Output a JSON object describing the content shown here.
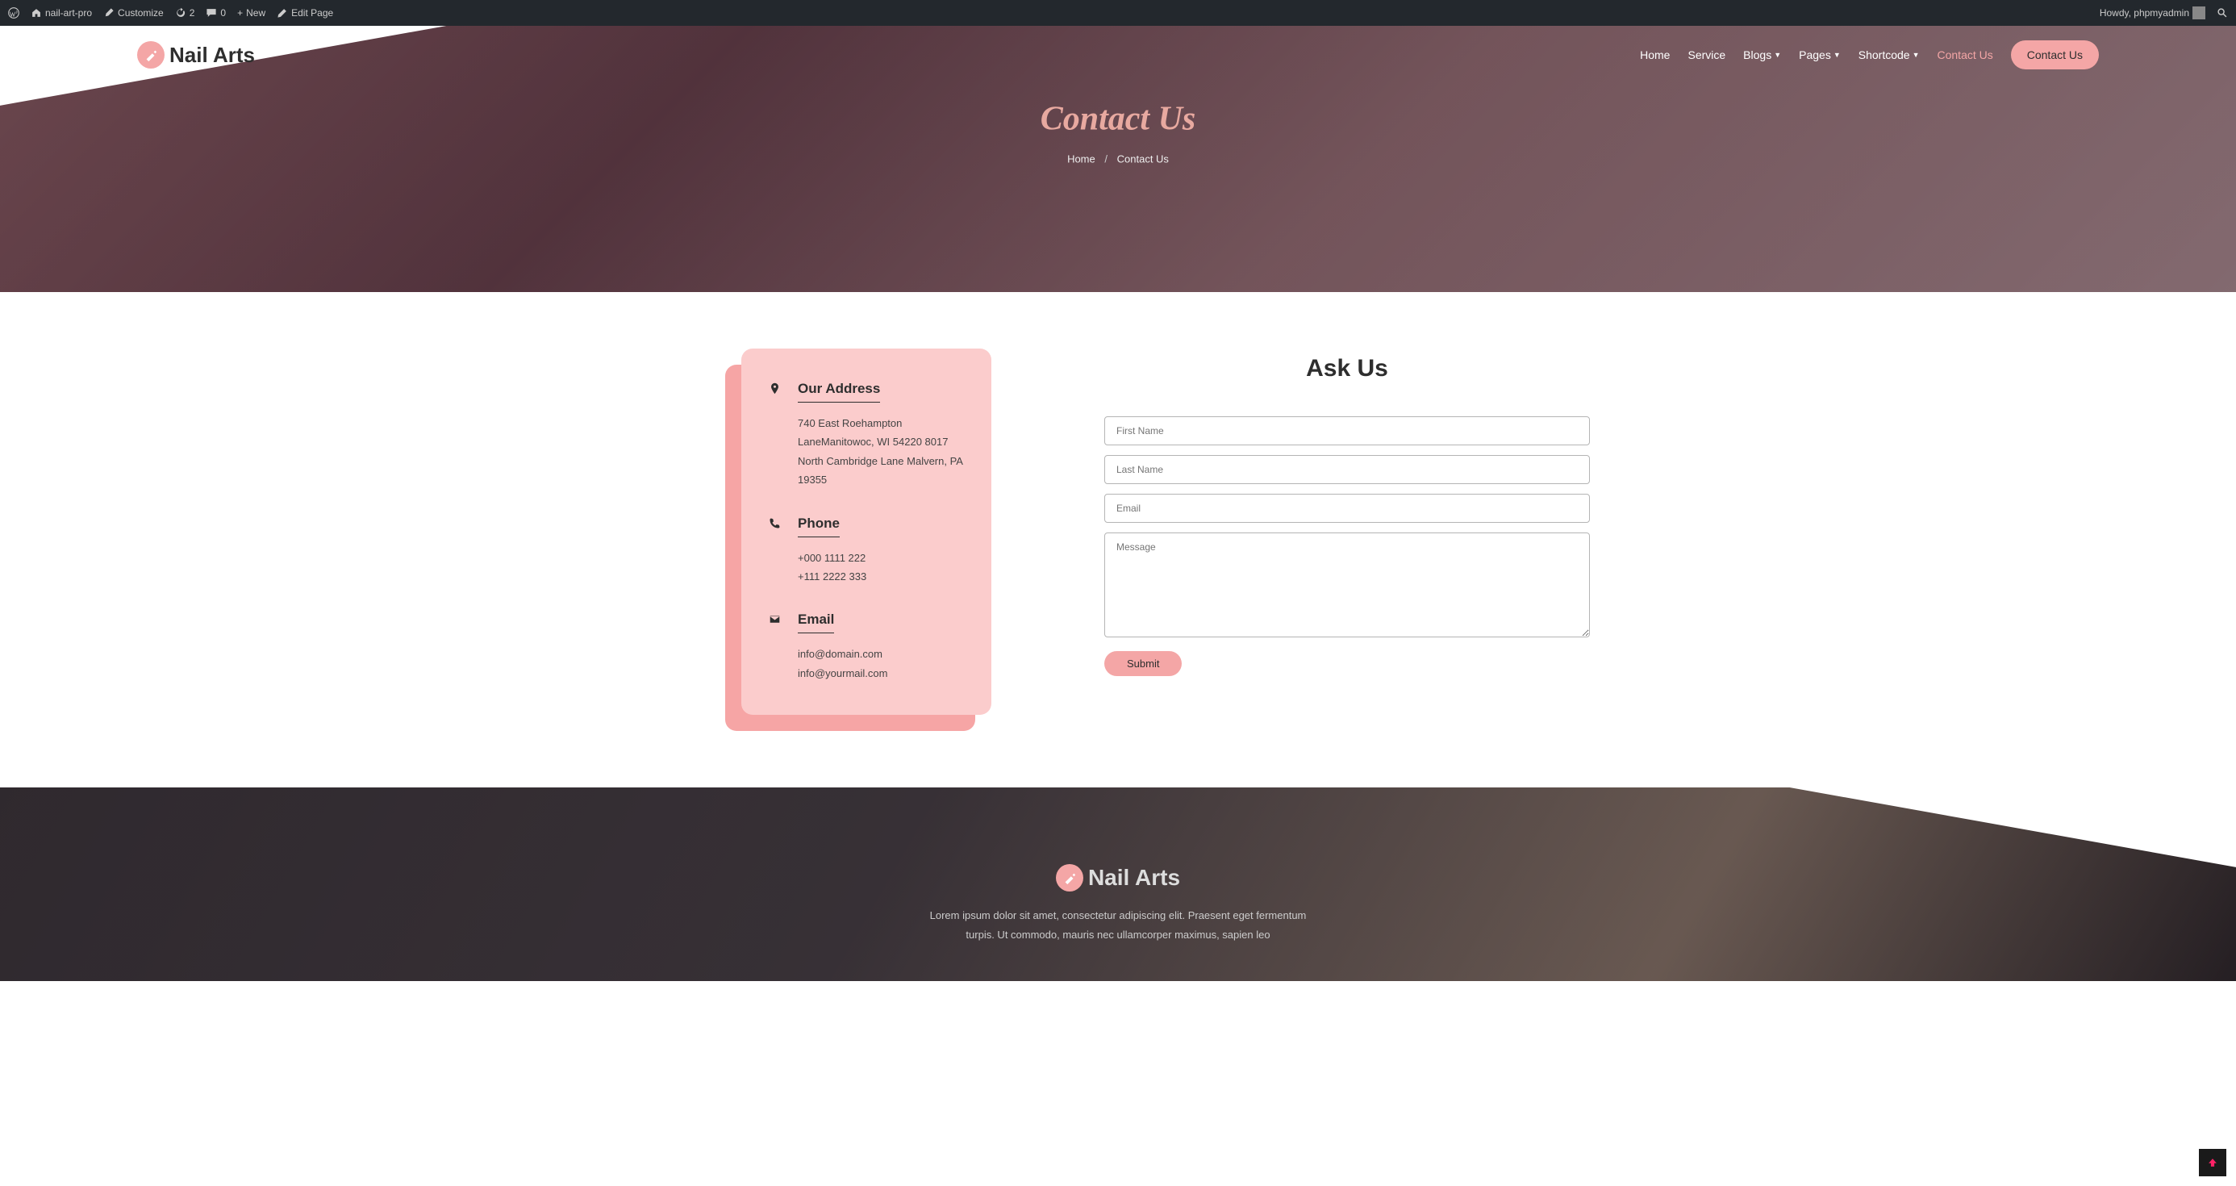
{
  "wp_bar": {
    "site_name": "nail-art-pro",
    "customize": "Customize",
    "updates_count": "2",
    "comments_count": "0",
    "new_label": "New",
    "edit_page": "Edit Page",
    "howdy": "Howdy, phpmyadmin"
  },
  "brand": {
    "name": "Nail Arts"
  },
  "nav": {
    "home": "Home",
    "service": "Service",
    "blogs": "Blogs",
    "pages": "Pages",
    "shortcode": "Shortcode",
    "contact_us": "Contact Us",
    "btn": "Contact Us"
  },
  "hero": {
    "title": "Contact Us",
    "breadcrumb_home": "Home",
    "breadcrumb_current": "Contact Us"
  },
  "contact": {
    "address": {
      "title": "Our Address",
      "line1": "740 East Roehampton",
      "line2": "LaneManitowoc, WI 54220 8017",
      "line3": "North Cambridge Lane Malvern, PA 19355"
    },
    "phone": {
      "title": "Phone",
      "p1": "+000 1111 222",
      "p2": "+111 2222 333"
    },
    "email": {
      "title": "Email",
      "e1": "info@domain.com",
      "e2": "info@yourmail.com"
    }
  },
  "form": {
    "title": "Ask Us",
    "first_name_ph": "First Name",
    "last_name_ph": "Last Name",
    "email_ph": "Email",
    "message_ph": "Message",
    "submit": "Submit"
  },
  "footer": {
    "text": "Lorem ipsum dolor sit amet, consectetur adipiscing elit. Praesent eget fermentum turpis. Ut commodo, mauris nec ullamcorper maximus, sapien leo"
  }
}
